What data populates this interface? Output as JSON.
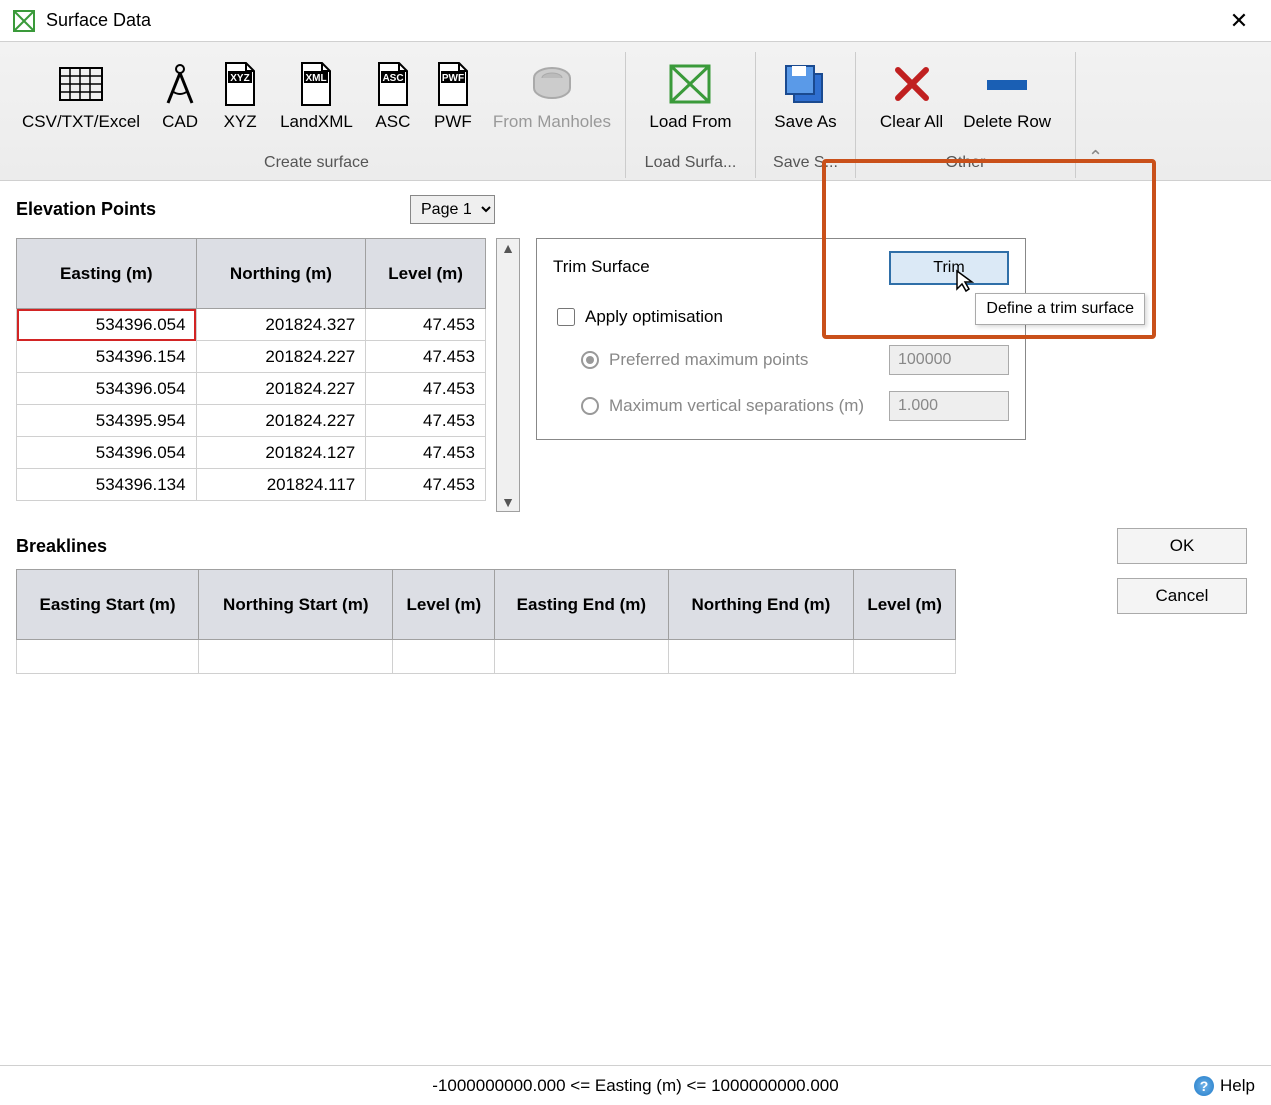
{
  "window": {
    "title": "Surface Data"
  },
  "ribbon": {
    "groups": [
      {
        "label": "Create surface",
        "buttons": [
          {
            "name": "csv-txt-excel-button",
            "label": "CSV/TXT/Excel",
            "icon": "grid-icon"
          },
          {
            "name": "cad-button",
            "label": "CAD",
            "icon": "compass-icon"
          },
          {
            "name": "xyz-button",
            "label": "XYZ",
            "icon": "xyz-file-icon"
          },
          {
            "name": "landxml-button",
            "label": "LandXML",
            "icon": "xml-file-icon"
          },
          {
            "name": "asc-button",
            "label": "ASC",
            "icon": "asc-file-icon"
          },
          {
            "name": "pwf-button",
            "label": "PWF",
            "icon": "pwf-file-icon"
          },
          {
            "name": "from-manholes-button",
            "label": "From Manholes",
            "icon": "manhole-icon",
            "disabled": true
          }
        ]
      },
      {
        "label": "Load Surfa...",
        "buttons": [
          {
            "name": "load-from-button",
            "label": "Load From",
            "icon": "surface-icon"
          }
        ]
      },
      {
        "label": "Save S...",
        "buttons": [
          {
            "name": "save-as-button",
            "label": "Save As",
            "icon": "save-icon"
          }
        ]
      },
      {
        "label": "Other",
        "buttons": [
          {
            "name": "clear-all-button",
            "label": "Clear All",
            "icon": "delete-x-icon"
          },
          {
            "name": "delete-row-button",
            "label": "Delete Row",
            "icon": "minus-icon"
          }
        ]
      }
    ]
  },
  "elevation": {
    "label": "Elevation Points",
    "page_selector": "Page 1",
    "columns": [
      "Easting (m)",
      "Northing (m)",
      "Level (m)"
    ],
    "rows": [
      {
        "e": "534396.054",
        "n": "201824.327",
        "l": "47.453",
        "selected": true
      },
      {
        "e": "534396.154",
        "n": "201824.227",
        "l": "47.453"
      },
      {
        "e": "534396.054",
        "n": "201824.227",
        "l": "47.453"
      },
      {
        "e": "534395.954",
        "n": "201824.227",
        "l": "47.453"
      },
      {
        "e": "534396.054",
        "n": "201824.127",
        "l": "47.453"
      },
      {
        "e": "534396.134",
        "n": "201824.117",
        "l": "47.453"
      }
    ]
  },
  "trim": {
    "title": "Trim Surface",
    "button": "Trim",
    "tooltip": "Define a trim surface",
    "apply_label": "Apply optimisation",
    "apply_checked": false,
    "opt1_label": "Preferred maximum points",
    "opt1_value": "100000",
    "opt2_label": "Maximum vertical separations (m)",
    "opt2_value": "1.000"
  },
  "breaklines": {
    "label": "Breaklines",
    "columns": [
      "Easting Start (m)",
      "Northing Start (m)",
      "Level (m)",
      "Easting End (m)",
      "Northing End (m)",
      "Level (m)"
    ]
  },
  "footer": {
    "ok": "OK",
    "cancel": "Cancel"
  },
  "status": {
    "text": "-1000000000.000 <= Easting (m) <= 1000000000.000",
    "help": "Help"
  }
}
